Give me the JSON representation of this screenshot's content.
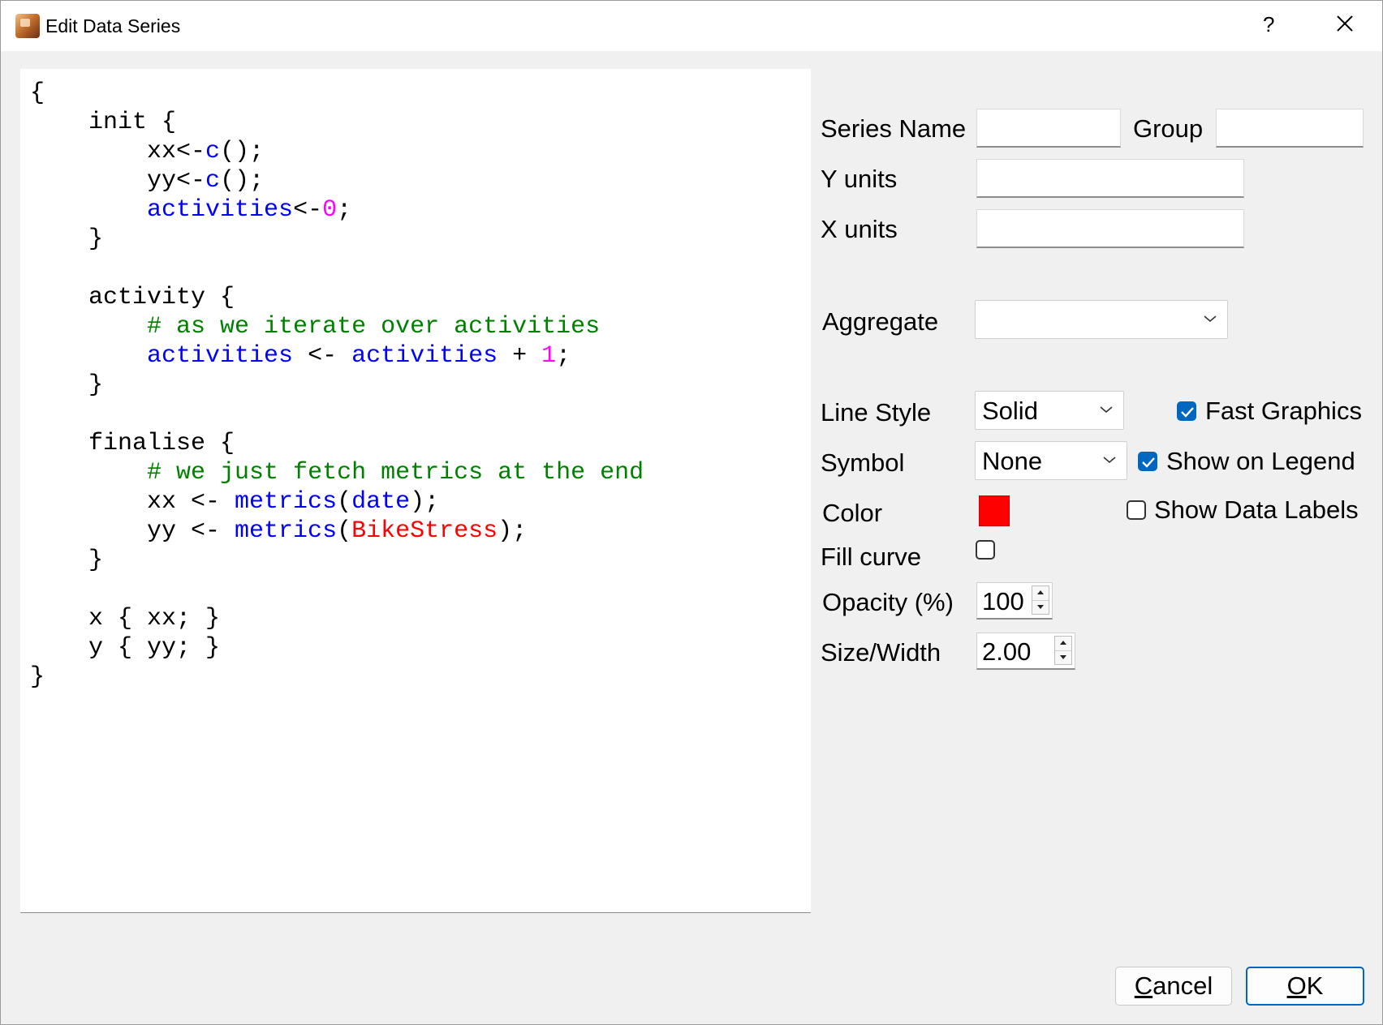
{
  "window": {
    "title": "Edit Data Series",
    "help_label": "?"
  },
  "editor": {
    "lines": [
      [
        {
          "t": "{"
        }
      ],
      [
        {
          "t": "    init {"
        }
      ],
      [
        {
          "t": "        xx<-"
        },
        {
          "t": "c",
          "c": "fn"
        },
        {
          "t": "();"
        }
      ],
      [
        {
          "t": "        yy<-"
        },
        {
          "t": "c",
          "c": "fn"
        },
        {
          "t": "();"
        }
      ],
      [
        {
          "t": "        "
        },
        {
          "t": "activities",
          "c": "fn"
        },
        {
          "t": "<-"
        },
        {
          "t": "0",
          "c": "num"
        },
        {
          "t": ";"
        }
      ],
      [
        {
          "t": "    }"
        }
      ],
      [
        {
          "t": ""
        }
      ],
      [
        {
          "t": "    activity {"
        }
      ],
      [
        {
          "t": "        "
        },
        {
          "t": "# as we iterate over activities",
          "c": "cm"
        }
      ],
      [
        {
          "t": "        "
        },
        {
          "t": "activities",
          "c": "fn"
        },
        {
          "t": " <- "
        },
        {
          "t": "activities",
          "c": "fn"
        },
        {
          "t": " + "
        },
        {
          "t": "1",
          "c": "num"
        },
        {
          "t": ";"
        }
      ],
      [
        {
          "t": "    }"
        }
      ],
      [
        {
          "t": ""
        }
      ],
      [
        {
          "t": "    finalise {"
        }
      ],
      [
        {
          "t": "        "
        },
        {
          "t": "# we just fetch metrics at the end",
          "c": "cm"
        }
      ],
      [
        {
          "t": "        xx <- "
        },
        {
          "t": "metrics",
          "c": "fn"
        },
        {
          "t": "("
        },
        {
          "t": "date",
          "c": "fn"
        },
        {
          "t": ");"
        }
      ],
      [
        {
          "t": "        yy <- "
        },
        {
          "t": "metrics",
          "c": "fn"
        },
        {
          "t": "("
        },
        {
          "t": "BikeStress",
          "c": "str"
        },
        {
          "t": ");"
        }
      ],
      [
        {
          "t": "    }"
        }
      ],
      [
        {
          "t": ""
        }
      ],
      [
        {
          "t": "    x { xx; }"
        }
      ],
      [
        {
          "t": "    y { yy; }"
        }
      ],
      [
        {
          "t": "}"
        }
      ]
    ]
  },
  "form": {
    "series_name": {
      "label": "Series Name",
      "value": ""
    },
    "group": {
      "label": "Group",
      "value": ""
    },
    "y_units": {
      "label": "Y units",
      "value": ""
    },
    "x_units": {
      "label": "X units",
      "value": ""
    },
    "aggregate": {
      "label": "Aggregate",
      "value": ""
    },
    "line_style": {
      "label": "Line Style",
      "value": "Solid"
    },
    "symbol": {
      "label": "Symbol",
      "value": "None"
    },
    "color": {
      "label": "Color",
      "value": "#ff0000"
    },
    "fill_curve": {
      "label": "Fill curve",
      "checked": false
    },
    "opacity": {
      "label": "Opacity (%)",
      "value": "100"
    },
    "size_width": {
      "label": "Size/Width",
      "value": "2.00"
    },
    "fast_graphics": {
      "label": "Fast Graphics",
      "checked": true
    },
    "show_on_legend": {
      "label": "Show on Legend",
      "checked": true
    },
    "show_data_labels": {
      "label": "Show Data Labels",
      "checked": false
    }
  },
  "buttons": {
    "cancel": {
      "mnemonic": "C",
      "rest": "ancel"
    },
    "ok": {
      "mnemonic": "O",
      "rest": "K"
    }
  },
  "colors": {
    "accent": "#0067c0",
    "keyword": "#0000ff",
    "number": "#ff00ff",
    "comment": "#008000",
    "string": "#ff0000"
  }
}
